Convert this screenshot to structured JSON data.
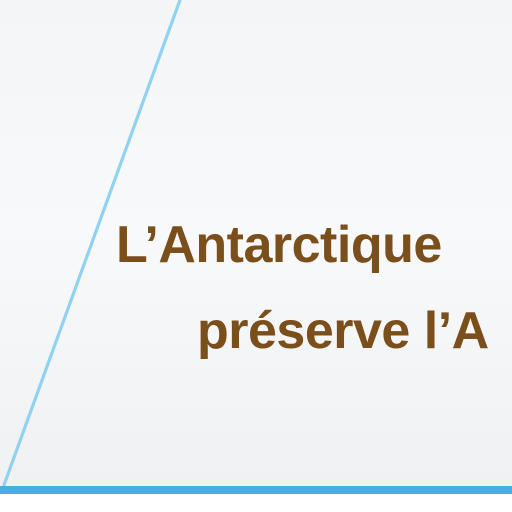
{
  "headline": {
    "line1": "L’Antarctique",
    "line2": "préserve l’A"
  },
  "colors": {
    "text": "#7a4f1c",
    "accent_line": "#8fd2f1",
    "bottom_bar": "#47aee0",
    "background_top": "#f3f5f7",
    "background_bottom": "#eef0f2"
  }
}
